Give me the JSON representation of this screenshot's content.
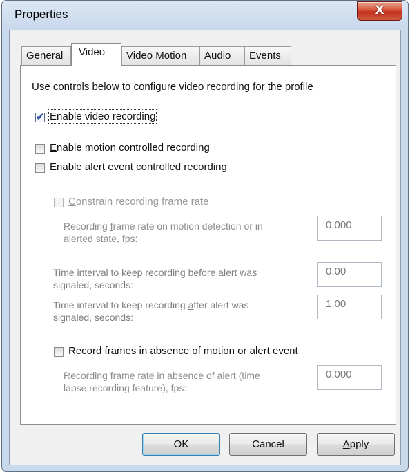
{
  "window": {
    "title": "Properties",
    "close_glyph": "X"
  },
  "tabs": [
    {
      "label": "General",
      "active": false
    },
    {
      "label": "Video",
      "active": true
    },
    {
      "label": "Video Motion",
      "active": false
    },
    {
      "label": "Audio",
      "active": false
    },
    {
      "label": "Events",
      "active": false
    }
  ],
  "panel": {
    "intro": "Use controls below to configure video recording for the profile",
    "enable_video": {
      "label": "Enable video recording",
      "checked": true
    },
    "enable_motion": {
      "label": "Enable motion controlled recording",
      "checked": false,
      "mnemonic": "E",
      "rest": "nable motion controlled recording"
    },
    "enable_alert": {
      "label": "Enable alert event controlled recording",
      "checked": false,
      "pre": "Enable a",
      "mnemonic": "l",
      "post": "ert event controlled recording"
    },
    "constrain": {
      "label": "Constrain recording frame rate",
      "checked": false,
      "mnemonic": "C",
      "rest": "onstrain recording frame rate"
    },
    "frame_rate_motion": {
      "line1_pre": "Recording ",
      "line1_mn": "f",
      "line1_post": "rame rate on motion detection or in",
      "line2": "alerted state, fps:",
      "value": "0.000"
    },
    "interval_before": {
      "line1_pre": "Time interval to keep recording ",
      "line1_mn": "b",
      "line1_post": "efore alert was",
      "line2": "signaled, seconds:",
      "value": "0.00"
    },
    "interval_after": {
      "line1_pre": "Time interval to keep recording ",
      "line1_mn": "a",
      "line1_post": "fter alert was",
      "line2": "signaled, seconds:",
      "value": "1.00"
    },
    "record_absence": {
      "label": "Record frames in absence of motion or alert event",
      "checked": false,
      "pre": "Record frames in ab",
      "mnemonic": "s",
      "post": "ence of motion or alert event"
    },
    "frame_rate_absence": {
      "line1_pre": "Recording ",
      "line1_mn": "f",
      "line1_post": "rame rate in absence of alert (time",
      "line2": "lapse recording feature), fps:",
      "value": "0.000"
    }
  },
  "buttons": {
    "ok": "OK",
    "cancel": "Cancel",
    "apply_mnemonic": "A",
    "apply_rest": "pply"
  },
  "colors": {
    "window_frame": "#c9d9ec",
    "close_button": "#c2301c",
    "checkbox_check": "#2b4aa0",
    "default_button_border": "#3c7fb1"
  },
  "icons": {
    "close": "close-icon",
    "check": "checkmark-icon"
  }
}
